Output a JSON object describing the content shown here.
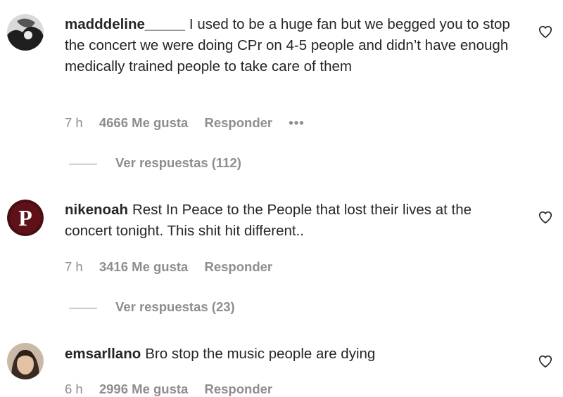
{
  "comments": [
    {
      "username": "madddeline_____",
      "text": "I used to be a huge fan but we begged you to stop the concert we were doing CPr on 4-5 people and didn’t have enough medically trained people to take care of them",
      "time": "7 h",
      "likes": "4666 Me gusta",
      "reply_label": "Responder",
      "more_label": "•••",
      "view_replies": "Ver respuestas (112)"
    },
    {
      "username": "nikenoah",
      "text": "Rest In Peace to the People that lost their lives at the concert tonight. This shit hit different..",
      "time": "7 h",
      "likes": "3416 Me gusta",
      "reply_label": "Responder",
      "view_replies": "Ver respuestas (23)"
    },
    {
      "username": "emsarllano",
      "text": "Bro stop the music people are dying",
      "time": "6 h",
      "likes": "2996 Me gusta",
      "reply_label": "Responder"
    }
  ],
  "icons": {
    "like": "heart-icon",
    "avatar_2_letter": "P"
  }
}
